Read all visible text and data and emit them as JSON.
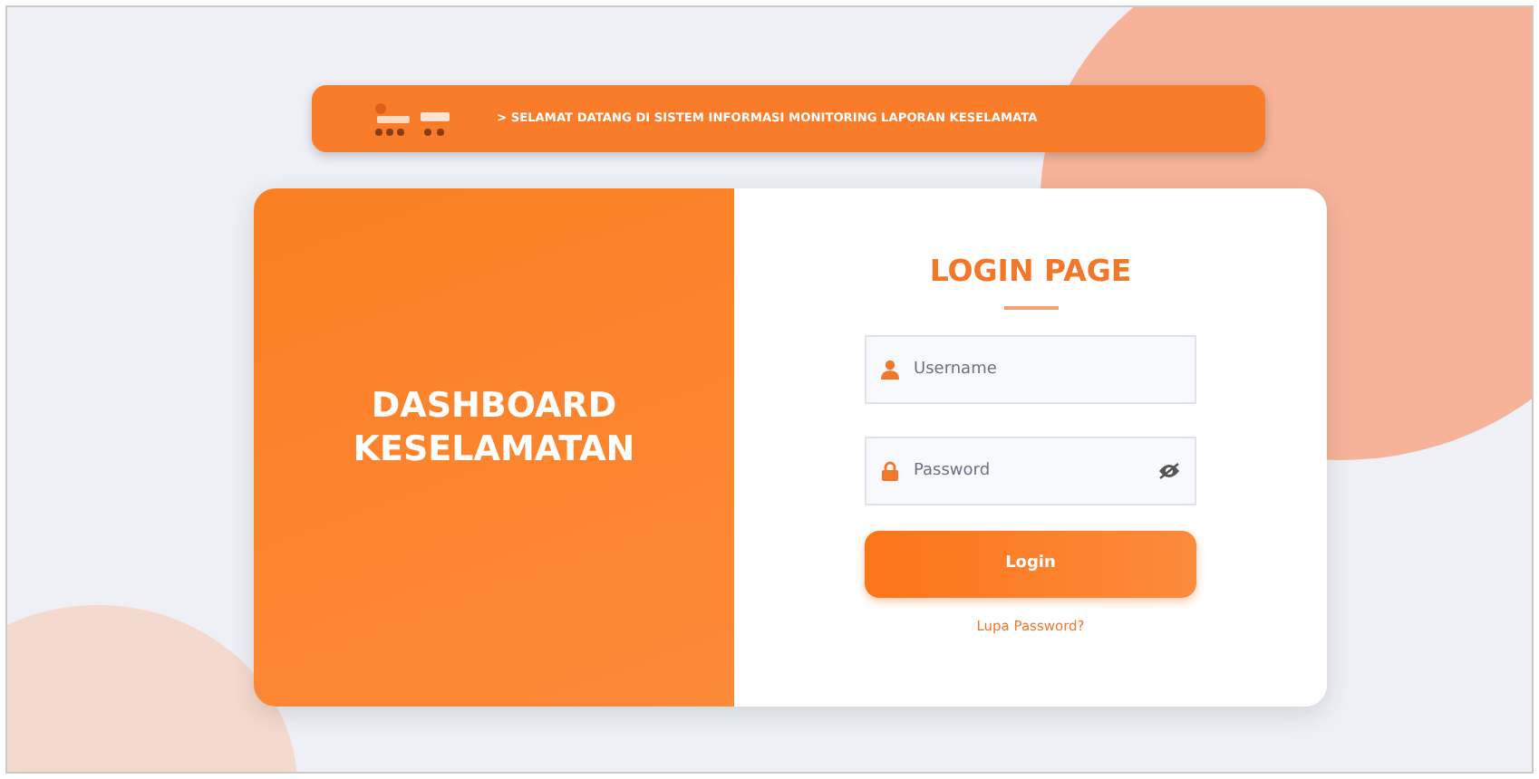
{
  "banner": {
    "text": "> SELAMAT DATANG DI SISTEM INFORMASI MONITORING LAPORAN KESELAMATA"
  },
  "brand_panel": {
    "title": "DASHBOARD KESELAMATAN"
  },
  "login": {
    "title": "LOGIN PAGE",
    "fields": [
      {
        "kind": "user",
        "placeholder": "Username"
      },
      {
        "kind": "password",
        "placeholder": "Password"
      }
    ],
    "button": "Login",
    "link": "Lupa Password?"
  }
}
